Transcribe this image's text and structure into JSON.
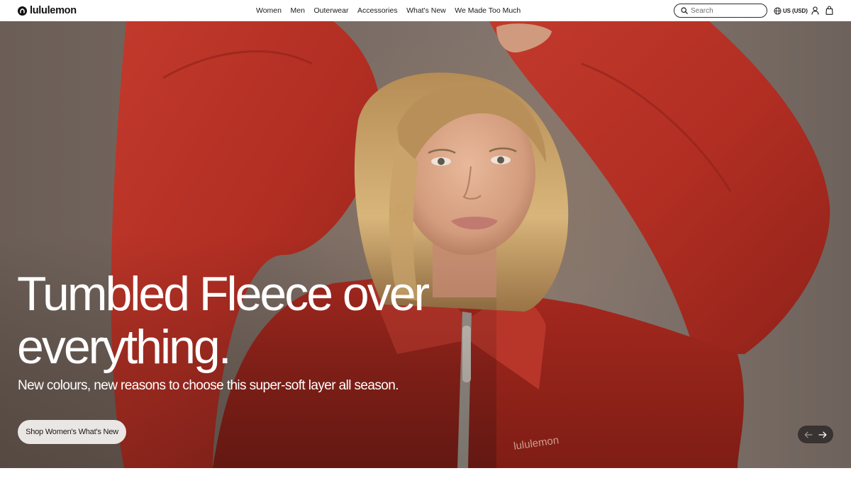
{
  "brand": {
    "name": "lululemon",
    "logo_icon": "lululemon-omega-logo",
    "accent_color": "#d31f26"
  },
  "nav": {
    "items": [
      {
        "label": "Women"
      },
      {
        "label": "Men"
      },
      {
        "label": "Outerwear"
      },
      {
        "label": "Accessories"
      },
      {
        "label": "What's New"
      },
      {
        "label": "We Made Too Much"
      }
    ]
  },
  "search": {
    "placeholder": "Search",
    "value": "",
    "icon": "search-icon"
  },
  "locale": {
    "label": "US (USD)",
    "icon": "globe-icon"
  },
  "account": {
    "icon": "account-icon"
  },
  "bag": {
    "icon": "shopping-bag-icon"
  },
  "hero": {
    "title": "Tumbled Fleece over everything.",
    "subtitle": "New colours, new reasons to choose this super-soft layer all season.",
    "cta_label": "Shop Women's What's New",
    "garment_print": "lululemon",
    "carousel": {
      "prev_icon": "arrow-left-icon",
      "next_icon": "arrow-right-icon"
    }
  }
}
